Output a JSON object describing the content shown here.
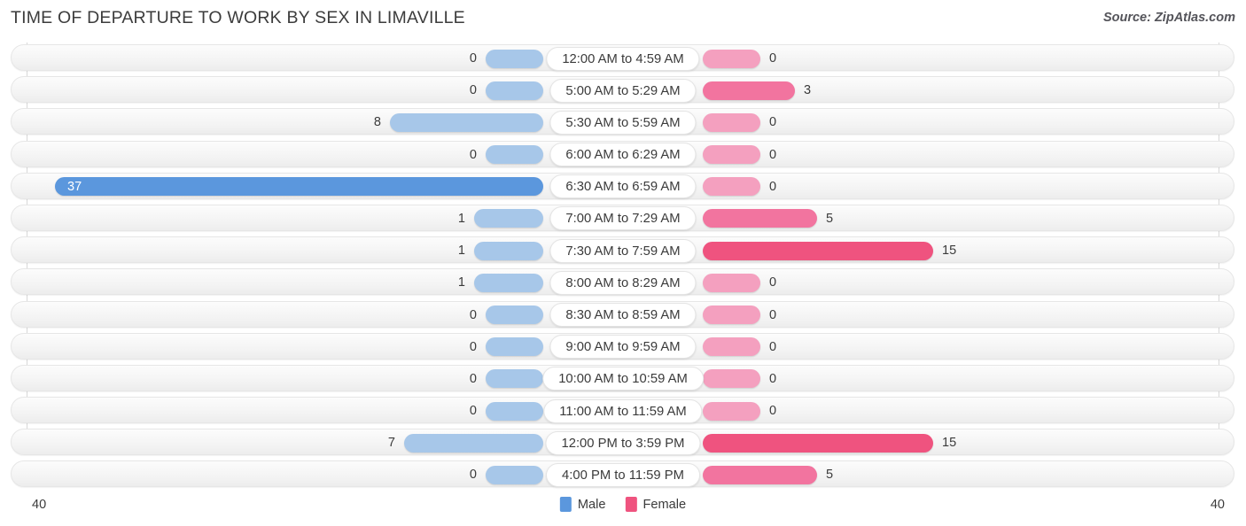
{
  "header": {
    "title": "TIME OF DEPARTURE TO WORK BY SEX IN LIMAVILLE",
    "source": "Source: ZipAtlas.com"
  },
  "legend": {
    "male_label": "Male",
    "female_label": "Female",
    "male_color": "#5b97dd",
    "female_color": "#ef537f"
  },
  "axis": {
    "left_max": "40",
    "right_max": "40"
  },
  "chart_data": {
    "type": "bar",
    "orientation": "horizontal-diverging",
    "title": "TIME OF DEPARTURE TO WORK BY SEX IN LIMAVILLE",
    "xlabel": "",
    "ylabel": "",
    "axis_max": 40,
    "grid": false,
    "legend_position": "bottom-center",
    "categories": [
      "12:00 AM to 4:59 AM",
      "5:00 AM to 5:29 AM",
      "5:30 AM to 5:59 AM",
      "6:00 AM to 6:29 AM",
      "6:30 AM to 6:59 AM",
      "7:00 AM to 7:29 AM",
      "7:30 AM to 7:59 AM",
      "8:00 AM to 8:29 AM",
      "8:30 AM to 8:59 AM",
      "9:00 AM to 9:59 AM",
      "10:00 AM to 10:59 AM",
      "11:00 AM to 11:59 AM",
      "12:00 PM to 3:59 PM",
      "4:00 PM to 11:59 PM"
    ],
    "series": [
      {
        "name": "Male",
        "values": [
          0,
          0,
          8,
          0,
          37,
          1,
          1,
          1,
          0,
          0,
          0,
          0,
          7,
          0
        ]
      },
      {
        "name": "Female",
        "values": [
          0,
          3,
          0,
          0,
          0,
          5,
          15,
          0,
          0,
          0,
          0,
          0,
          15,
          5
        ]
      }
    ]
  },
  "rows": [
    {
      "label": "12:00 AM to 4:59 AM",
      "male": "0",
      "female": "0",
      "male_w": 65,
      "female_w": 65,
      "male_style": "",
      "female_style": "",
      "male_inside": false
    },
    {
      "label": "5:00 AM to 5:29 AM",
      "male": "0",
      "female": "3",
      "male_w": 65,
      "female_w": 104,
      "male_style": "",
      "female_style": "mid",
      "male_inside": false
    },
    {
      "label": "5:30 AM to 5:59 AM",
      "male": "8",
      "female": "0",
      "male_w": 173,
      "female_w": 65,
      "male_style": "",
      "female_style": "",
      "male_inside": false
    },
    {
      "label": "6:00 AM to 6:29 AM",
      "male": "0",
      "female": "0",
      "male_w": 65,
      "female_w": 65,
      "male_style": "",
      "female_style": "",
      "male_inside": false
    },
    {
      "label": "6:30 AM to 6:59 AM",
      "male": "37",
      "female": "0",
      "male_w": 551,
      "female_w": 65,
      "male_style": "hi",
      "female_style": "",
      "male_inside": true
    },
    {
      "label": "7:00 AM to 7:29 AM",
      "male": "1",
      "female": "5",
      "male_w": 78,
      "female_w": 129,
      "male_style": "",
      "female_style": "mid",
      "male_inside": false
    },
    {
      "label": "7:30 AM to 7:59 AM",
      "male": "1",
      "female": "15",
      "male_w": 78,
      "female_w": 260,
      "male_style": "",
      "female_style": "hi",
      "male_inside": false
    },
    {
      "label": "8:00 AM to 8:29 AM",
      "male": "1",
      "female": "0",
      "male_w": 78,
      "female_w": 65,
      "male_style": "",
      "female_style": "",
      "male_inside": false
    },
    {
      "label": "8:30 AM to 8:59 AM",
      "male": "0",
      "female": "0",
      "male_w": 65,
      "female_w": 65,
      "male_style": "",
      "female_style": "",
      "male_inside": false
    },
    {
      "label": "9:00 AM to 9:59 AM",
      "male": "0",
      "female": "0",
      "male_w": 65,
      "female_w": 65,
      "male_style": "",
      "female_style": "",
      "male_inside": false
    },
    {
      "label": "10:00 AM to 10:59 AM",
      "male": "0",
      "female": "0",
      "male_w": 65,
      "female_w": 65,
      "male_style": "",
      "female_style": "",
      "male_inside": false
    },
    {
      "label": "11:00 AM to 11:59 AM",
      "male": "0",
      "female": "0",
      "male_w": 65,
      "female_w": 65,
      "male_style": "",
      "female_style": "",
      "male_inside": false
    },
    {
      "label": "12:00 PM to 3:59 PM",
      "male": "7",
      "female": "15",
      "male_w": 157,
      "female_w": 260,
      "male_style": "",
      "female_style": "hi",
      "male_inside": false
    },
    {
      "label": "4:00 PM to 11:59 PM",
      "male": "0",
      "female": "5",
      "male_w": 65,
      "female_w": 129,
      "male_style": "",
      "female_style": "mid",
      "male_inside": false
    }
  ]
}
